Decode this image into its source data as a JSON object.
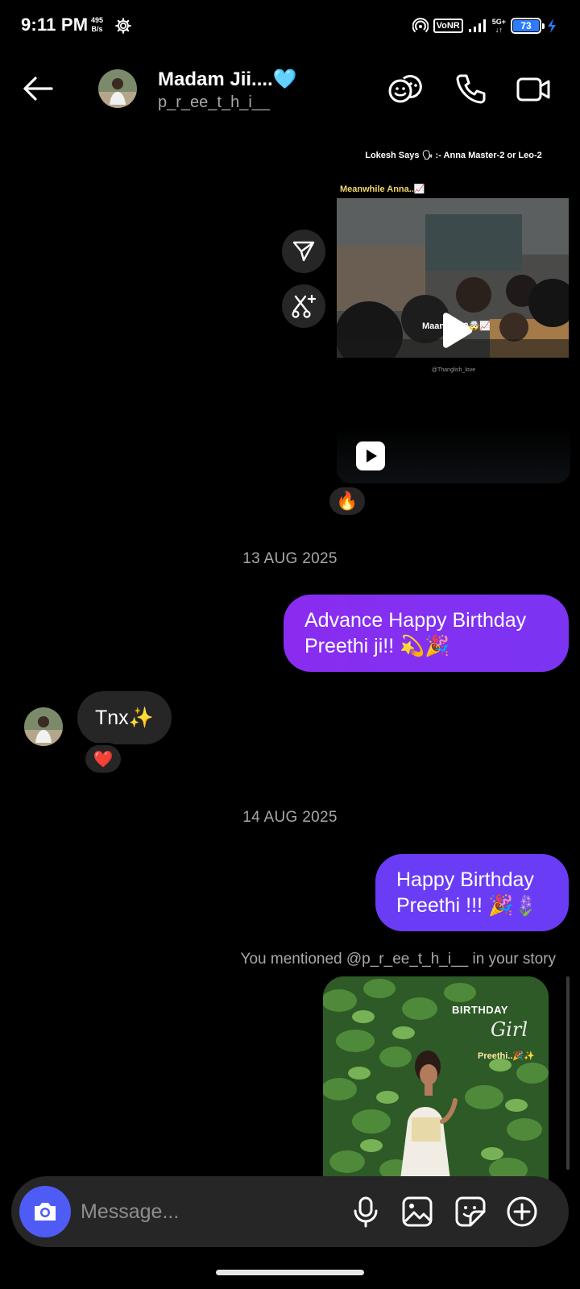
{
  "status_bar": {
    "time": "9:11 PM",
    "net_speed_value": "495",
    "net_speed_unit": "B/s",
    "vonr": "VoNR",
    "network_type": "5G+",
    "battery": "73"
  },
  "header": {
    "name": "Madam Jii....🩵",
    "handle": "p_r_ee_t_h_i__"
  },
  "reel": {
    "caption_top": "Lokesh Says 🗣 :- Anna Master-2 or Leo-2",
    "meanwhile": "Meanwhile Anna..📈",
    "overlay": "Maanadu-2🤯📈",
    "watermark": "@Thanglish_love",
    "reaction": "🔥"
  },
  "messages": [
    {
      "type": "date",
      "text": "13 AUG 2025"
    },
    {
      "type": "outgoing",
      "text": "Advance Happy Birthday Preethi ji!! 💫🎉"
    },
    {
      "type": "incoming",
      "text": "Tnx✨",
      "reaction": "❤️"
    },
    {
      "type": "date",
      "text": "14 AUG 2025"
    },
    {
      "type": "outgoing",
      "text": "Happy Birthday Preethi !!! 🎉🪻"
    }
  ],
  "story_mention": {
    "note": "You mentioned @p_r_ee_t_h_i__ in your story",
    "story_title": "BIRTHDAY",
    "story_subtitle": "Girl",
    "story_name": "Preethi..🎉✨"
  },
  "composer": {
    "placeholder": "Message..."
  },
  "colors": {
    "outgoing_bubble_1": "#8a2cf0",
    "outgoing_bubble_2": "#6a3cf5",
    "incoming_bubble": "#262626",
    "camera_button": "#4f5bf5",
    "battery": "#2b7cff"
  },
  "icons": [
    "back-arrow-icon",
    "emoji-faces-icon",
    "phone-icon",
    "video-camera-icon",
    "share-icon",
    "remix-icon",
    "play-icon",
    "reel-icon",
    "camera-icon",
    "microphone-icon",
    "gallery-icon",
    "sticker-icon",
    "plus-icon"
  ]
}
